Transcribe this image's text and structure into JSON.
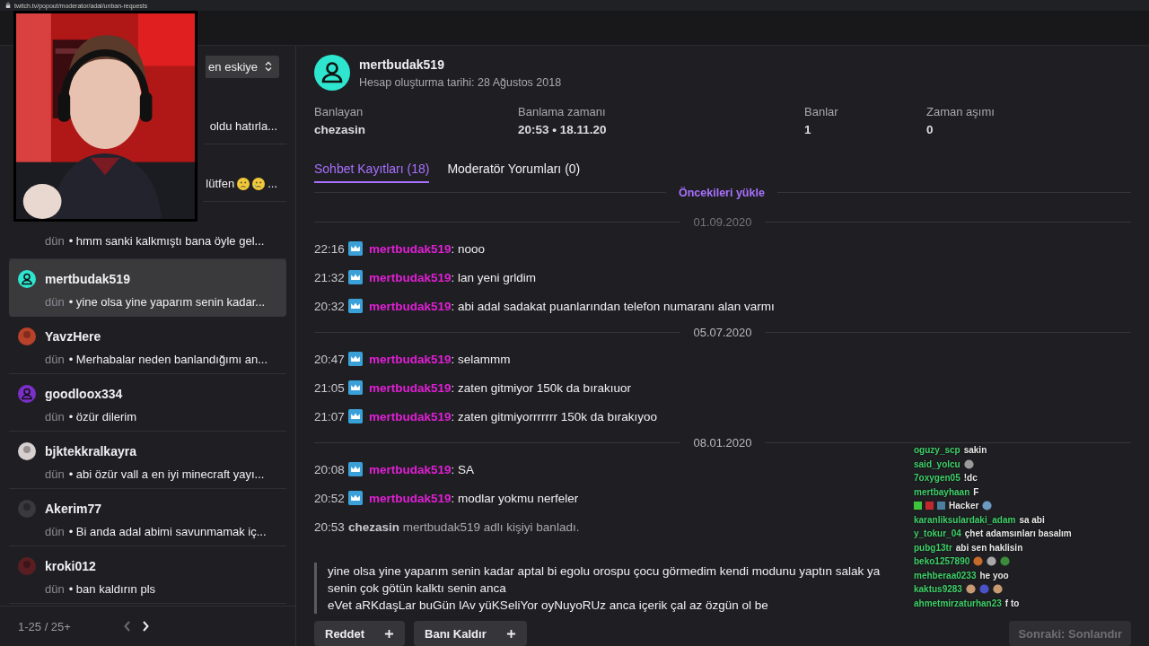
{
  "browser": {
    "url": "twitch.tv/popout/moderator/adal/unban-requests"
  },
  "sidebar": {
    "sort": {
      "label": "en eskiye"
    },
    "items": [
      {
        "kind": "partial",
        "message": "oldu hatırla...",
        "selected": false
      },
      {
        "kind": "emoji",
        "message": "lütfen",
        "trail": "...",
        "selected": false
      },
      {
        "kind": "timed",
        "time": "dün",
        "message": "• hmm sanki kalkmıştı bana öyle gel...",
        "selected": false
      },
      {
        "kind": "person",
        "color": "#2ee6cf",
        "name": "mertbudak519",
        "time": "dün",
        "message": "• yine olsa yine yaparım senin kadar...",
        "selected": true
      },
      {
        "color": "#b8412a",
        "name": "YavzHere",
        "time": "dün",
        "message": "• Merhabalar neden banlandığımı an...",
        "selected": false
      },
      {
        "kind": "person",
        "color": "#7b2fc9",
        "name": "goodloox334",
        "time": "dün",
        "message": "• özür dilerim",
        "selected": false
      },
      {
        "color": "#d8cfcf",
        "name": "bjktekkralkayra",
        "time": "dün",
        "message": "• abi özür vall a en iyi minecraft yayı...",
        "selected": false
      },
      {
        "color": "#3a3a3e",
        "name": "Akerim77",
        "time": "dün",
        "message": "• Bi anda adal abimi savunmamak iç...",
        "selected": false
      },
      {
        "color": "#5a1e22",
        "name": "kroki012",
        "time": "dün",
        "message": "• ban kaldırın pls",
        "selected": false
      }
    ],
    "pagination": {
      "range": "1-25 / 25+",
      "prev_disabled": true,
      "next_disabled": false
    }
  },
  "request": {
    "username": "mertbudak519",
    "created": "Hesap oluşturma tarihi: 28 Ağustos 2018",
    "avatar": {
      "color": "#2ee6cf"
    },
    "stats": [
      {
        "label": "Banlayan",
        "value": "chezasin"
      },
      {
        "label": "Banlama zamanı",
        "value": "20:53 • 18.11.20"
      },
      {
        "label": "Banlar",
        "value": "1"
      },
      {
        "label": "Zaman aşımı",
        "value": "0"
      }
    ],
    "tabs": [
      {
        "label": "Sohbet Kayıtları (18)",
        "selected": true
      },
      {
        "label": "Moderatör Yorumları (0)",
        "selected": false
      }
    ],
    "load_more": "Öncekileri yükle",
    "log": [
      {
        "kind": "date",
        "text": "01.09.2020",
        "faded": true
      },
      {
        "kind": "message",
        "time": "22:16",
        "user": "mertbudak519",
        "text": ": nooo"
      },
      {
        "kind": "message",
        "time": "21:32",
        "user": "mertbudak519",
        "text": ": lan yeni grldim"
      },
      {
        "kind": "message",
        "time": "20:32",
        "user": "mertbudak519",
        "text": ": abi adal sadakat puanlarından telefon numaranı alan varmı"
      },
      {
        "kind": "date",
        "text": "05.07.2020",
        "faded": false
      },
      {
        "kind": "message",
        "time": "20:47",
        "user": "mertbudak519",
        "text": ": selammm"
      },
      {
        "kind": "message",
        "time": "21:05",
        "user": "mertbudak519",
        "text": ": zaten gitmiyor 150k da bırakıuor"
      },
      {
        "kind": "message",
        "time": "21:07",
        "user": "mertbudak519",
        "text": ": zaten gitmiyorrrrrrr 150k da bırakıyoo"
      },
      {
        "kind": "date",
        "text": "08.01.2020",
        "faded": false
      },
      {
        "kind": "message",
        "time": "20:08",
        "user": "mertbudak519",
        "text": ": SA"
      },
      {
        "kind": "message",
        "time": "20:52",
        "user": "mertbudak519",
        "text": ": modlar yokmu nerfeler"
      },
      {
        "kind": "system",
        "time": "20:53",
        "moderator": "chezasin",
        "text": "mertbudak519 adlı kişiyi banladı."
      }
    ],
    "message": [
      "yine olsa yine yaparım senin kadar aptal bi egolu orospu çocu görmedim kendi modunu yaptın salak ya senin çok götün kalktı senin anca",
      "eVet aRKdaşLar buGün lAv yüKSeliYor oyNuyoRUz anca içerik çal az özgün ol be"
    ],
    "actions": [
      {
        "label": "Reddet"
      },
      {
        "label": "Banı Kaldır"
      }
    ]
  },
  "next_button": {
    "label": "Sonraki: Sonlandır",
    "disabled": true
  },
  "chat_overlay": [
    {
      "kind": "chat",
      "name": "oguzy_scp",
      "text": "sakin"
    },
    {
      "kind": "chat",
      "name": "said_yolcu",
      "emotes": [
        {
          "color": "#9a9a9a"
        }
      ]
    },
    {
      "kind": "chat",
      "name": "7oxygen05",
      "text": "!dc"
    },
    {
      "kind": "chat",
      "name": "mertbayhaan",
      "text": "F"
    },
    {
      "kind": "badges",
      "badges": [
        {
          "color": "#3cc43c"
        },
        {
          "color": "#c0282d"
        },
        {
          "color": "#4a7fa0"
        }
      ],
      "text": "Hacker",
      "emotes": [
        {
          "color": "#6d9ac0"
        }
      ]
    },
    {
      "kind": "chat",
      "name": "karanliksulardaki_adam",
      "text": "sa abi"
    },
    {
      "kind": "chat",
      "name": "y_tokur_04",
      "text": "çhet adamsınları basalım"
    },
    {
      "kind": "chat",
      "name": "pubg13tr",
      "text": "abi sen haklisin"
    },
    {
      "kind": "chat",
      "name": "beko1257890",
      "emotes": [
        {
          "color": "#c46a2a"
        },
        {
          "color": "#a8a8a8"
        },
        {
          "color": "#3c8a3c"
        }
      ]
    },
    {
      "kind": "chat",
      "name": "mehberaa0233",
      "text": "he yoo"
    },
    {
      "kind": "chat",
      "name": "kaktus9283",
      "emotes": [
        {
          "color": "#c89a72"
        },
        {
          "color": "#4a52c8"
        },
        {
          "color": "#c89a72"
        }
      ]
    },
    {
      "kind": "chat",
      "name": "ahmetmirzaturhan23",
      "text": "f to"
    }
  ]
}
